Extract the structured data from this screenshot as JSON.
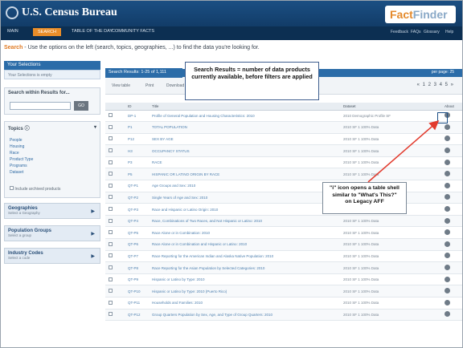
{
  "header": {
    "logo": "U.S. Census Bureau",
    "finder_logo_a": "Fact",
    "finder_logo_b": "Finder"
  },
  "nav": {
    "items": [
      "MAIN",
      "SEARCH",
      "TABLE OF THE DAY",
      "COMMUNITY FACTS"
    ],
    "right": [
      "Feedback",
      "FAQs",
      "Glossary",
      "Help"
    ]
  },
  "hint": {
    "prefix": "Search",
    "text": " - Use the options on the left (search, topics, geographies, ...) to find the data you're looking for."
  },
  "sidebar": {
    "selections_title": "Your Selections",
    "selections_sub": "Your Selections is empty",
    "search_title": "Search within Results for...",
    "go_label": "GO",
    "topics_title": "Topics",
    "topics": [
      "People",
      "Housing",
      "Race",
      "Product Type",
      "Programs",
      "Dataset"
    ],
    "include_archived": "Include archived products",
    "geographies": {
      "title": "Geographies",
      "sub": "Select a Geography"
    },
    "population_groups": {
      "title": "Population Groups",
      "sub": "Select a group"
    },
    "industry_codes": {
      "title": "Industry Codes",
      "sub": "Select a code"
    }
  },
  "results": {
    "header": "Search Results: 1-25 of 1,111",
    "per_page_label": "per page:",
    "per_page": "25",
    "tools": [
      "View table",
      "Print",
      "Download"
    ],
    "pager": "« 1 2 3 4 5 »",
    "columns": [
      "",
      "ID",
      "Title",
      "Dataset",
      "About"
    ],
    "rows": [
      {
        "id": "DP-1",
        "title": "Profile of General Population and Housing Characteristics: 2010",
        "dataset": "2010 Demographic Profile SF"
      },
      {
        "id": "P1",
        "title": "TOTAL POPULATION",
        "dataset": "2010 SF 1 100% Data"
      },
      {
        "id": "P12",
        "title": "SEX BY AGE",
        "dataset": "2010 SF 1 100% Data"
      },
      {
        "id": "H3",
        "title": "OCCUPANCY STATUS",
        "dataset": "2010 SF 1 100% Data"
      },
      {
        "id": "P3",
        "title": "RACE",
        "dataset": "2010 SF 1 100% Data"
      },
      {
        "id": "P5",
        "title": "HISPANIC OR LATINO ORIGIN BY RACE",
        "dataset": "2010 SF 1 100% Data"
      },
      {
        "id": "QT-P1",
        "title": "Age Groups and Sex: 2010",
        "dataset": "2010 SF 1 100% Data"
      },
      {
        "id": "QT-P2",
        "title": "Single Years of Age and Sex: 2010",
        "dataset": "2010 SF 1 100% Data"
      },
      {
        "id": "QT-P3",
        "title": "Race and Hispanic or Latino Origin: 2010",
        "dataset": "2010 SF 1 100% Data"
      },
      {
        "id": "QT-P4",
        "title": "Race, Combinations of Two Races, and Not Hispanic or Latino: 2010",
        "dataset": "2010 SF 1 100% Data"
      },
      {
        "id": "QT-P5",
        "title": "Race Alone or in Combination: 2010",
        "dataset": "2010 SF 1 100% Data"
      },
      {
        "id": "QT-P6",
        "title": "Race Alone or in Combination and Hispanic or Latino: 2010",
        "dataset": "2010 SF 1 100% Data"
      },
      {
        "id": "QT-P7",
        "title": "Race Reporting for the American Indian and Alaska Native Population: 2010",
        "dataset": "2010 SF 1 100% Data"
      },
      {
        "id": "QT-P8",
        "title": "Race Reporting for the Asian Population by Selected Categories: 2010",
        "dataset": "2010 SF 1 100% Data"
      },
      {
        "id": "QT-P9",
        "title": "Hispanic or Latino by Type: 2010",
        "dataset": "2010 SF 1 100% Data"
      },
      {
        "id": "QT-P10",
        "title": "Hispanic or Latino by Type: 2010 (Puerto Rico)",
        "dataset": "2010 SF 1 100% Data"
      },
      {
        "id": "QT-P11",
        "title": "Households and Families: 2010",
        "dataset": "2010 SF 1 100% Data"
      },
      {
        "id": "QT-P12",
        "title": "Group Quarters Population by Sex, Age, and Type of Group Quarters: 2010",
        "dataset": "2010 SF 1 100% Data"
      }
    ]
  },
  "callouts": {
    "search_results": "Search Results = number of data products currently available, before filters are applied",
    "info_icon_1": "\"i\" icon opens a table shell",
    "info_icon_2": "similar to \"What's This?\"",
    "info_icon_3": "on Legacy AFF"
  },
  "colors": {
    "header_blue": "#1b4f83",
    "accent_orange": "#e98d29",
    "results_blue": "#2b6ca8",
    "arrow_red": "#e23b2e"
  }
}
